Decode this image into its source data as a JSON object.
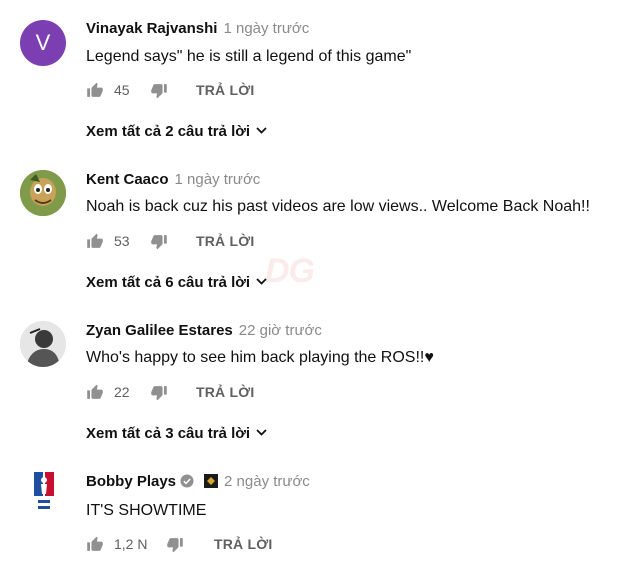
{
  "comments": [
    {
      "avatar_letter": "V",
      "author": "Vinayak Rajvanshi",
      "time": "1 ngày trước",
      "text": "Legend says\" he is still a legend of this game\"",
      "likes": "45",
      "reply_label": "TRẢ LỜI",
      "view_replies": "Xem tất cả 2 câu trả lời"
    },
    {
      "author": "Kent Caaco",
      "time": "1 ngày trước",
      "text": "Noah is back cuz his past videos are low views.. Welcome Back Noah!!",
      "likes": "53",
      "reply_label": "TRẢ LỜI",
      "view_replies": "Xem tất cả 6 câu trả lời"
    },
    {
      "author": "Zyan Galilee Estares",
      "time": "22 giờ trước",
      "text": "Who's happy to see him back playing the ROS!!♥",
      "likes": "22",
      "reply_label": "TRẢ LỜI",
      "view_replies": "Xem tất cả 3 câu trả lời"
    },
    {
      "author": "Bobby Plays",
      "time": "2 ngày trước",
      "text": "IT'S SHOWTIME",
      "likes": "1,2 N",
      "reply_label": "TRẢ LỜI"
    }
  ],
  "colors": {
    "avatar_v": "#7b3fb1",
    "meta_gray": "#8a8a8a",
    "icon_gray": "#909090"
  },
  "icons": [
    "thumb-up-icon",
    "thumb-down-icon",
    "chevron-down-icon",
    "verified-check-icon",
    "channel-badge-icon"
  ]
}
